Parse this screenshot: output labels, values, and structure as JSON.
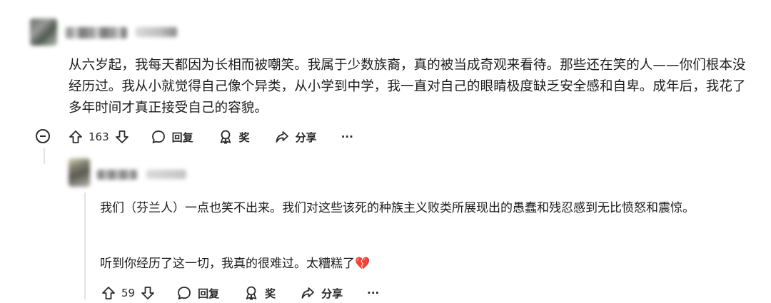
{
  "comment1": {
    "text": "从六岁起，我每天都因为长相而被嘲笑。我属于少数族裔，真的被当成奇观来看待。那些还在笑的人——你们根本没经历过。我从小就觉得自己像个异类，从小学到中学，我一直对自己的眼睛极度缺乏安全感和自卑。成年后，我花了多年时间才真正接受自己的容貌。",
    "upvotes": "163",
    "reply_label": "回复",
    "award_label": "奖",
    "share_label": "分享",
    "more_label": "···"
  },
  "comment2": {
    "text1": "我们（芬兰人）一点也笑不出来。我们对这些该死的种族主义败类所展现出的愚蠢和残忍感到无比愤怒和震惊。",
    "text2": "听到你经历了这一切，我真的很难过。太糟糕了",
    "emoji": "💔",
    "upvotes": "59",
    "reply_label": "回复",
    "award_label": "奖",
    "share_label": "分享",
    "more_label": "···"
  },
  "colors": {
    "text": "#1c1c1c",
    "heart": "#e0245e",
    "thread": "#e3e3e3"
  },
  "icons": [
    "collapse-icon",
    "upvote-icon",
    "downvote-icon",
    "comment-icon",
    "award-icon",
    "share-icon",
    "more-icon"
  ]
}
